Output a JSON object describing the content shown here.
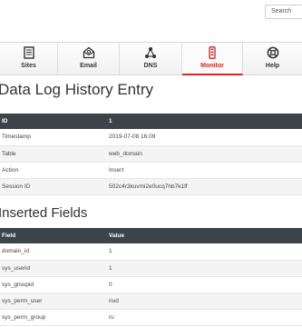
{
  "search": {
    "placeholder": "Search"
  },
  "nav": {
    "items": [
      {
        "label": "Sites",
        "icon": "sites-icon"
      },
      {
        "label": "Email",
        "icon": "email-icon"
      },
      {
        "label": "DNS",
        "icon": "dns-icon"
      },
      {
        "label": "Monitor",
        "icon": "monitor-icon",
        "active": true
      },
      {
        "label": "Help",
        "icon": "help-icon"
      }
    ],
    "active_color": "#c62828"
  },
  "entry": {
    "title": "Data Log History Entry",
    "header": {
      "key": "ID",
      "value": "1"
    },
    "rows": [
      {
        "key": "Timestamp",
        "value": "2019-07-08 16:09"
      },
      {
        "key": "Table",
        "value": "web_domain"
      },
      {
        "key": "Action",
        "value": "Insert"
      },
      {
        "key": "Session ID",
        "value": "502c4r3kuvmi2e0ucq7hb7k1ff"
      }
    ]
  },
  "fields": {
    "title": "Inserted Fields",
    "header": {
      "key": "Field",
      "value": "Value"
    },
    "rows": [
      {
        "key": "domain_id",
        "value": "1"
      },
      {
        "key": "sys_userid",
        "value": "1"
      },
      {
        "key": "sys_groupid",
        "value": "0"
      },
      {
        "key": "sys_perm_user",
        "value": "riud"
      },
      {
        "key": "sys_perm_group",
        "value": "ru"
      }
    ]
  }
}
